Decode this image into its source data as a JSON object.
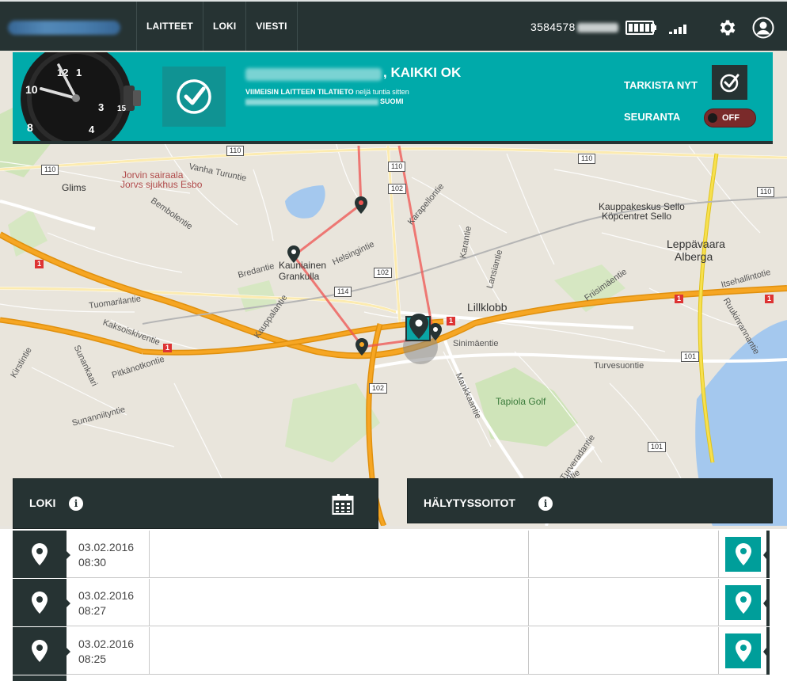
{
  "nav": {
    "links": [
      "LAITTEET",
      "LOKI",
      "VIESTI"
    ],
    "phone_prefix": "3584578",
    "battery_icon": "battery-full-icon",
    "signal_icon": "signal-bars-icon",
    "settings_icon": "gear-icon",
    "profile_icon": "user-icon"
  },
  "status": {
    "title": ", KAIKKI OK",
    "latest_prefix": "VIIMEISIN LAITTEEN TILATIETO",
    "latest_time": " neljä tuntia sitten",
    "country": "SUOMI",
    "check_now_label": "TARKISTA NYT",
    "follow_label": "SEURANTA",
    "follow_toggle": "OFF",
    "accent_color": "#00aaaa",
    "dark_color": "#263333"
  },
  "map": {
    "labels": {
      "jorvi": "Jorvin sairaala",
      "jorvs": "Jorvs sjukhus Esbo",
      "glims": "Glims",
      "vanha": "Vanha Turuntie",
      "bembole": "Bembolentie",
      "kauniainen": "Kauniainen",
      "grankulla": "Grankulla",
      "bredantie": "Bredantie",
      "helsingintie": "Helsingintie",
      "karapellontie": "Karapellontie",
      "kauppakeskus": "Kauppakeskus Sello",
      "kopcentret": "Köpcentret Sello",
      "leppavaara": "Leppävaara",
      "alberga": "Alberga",
      "lillklobb": "Lillklobb",
      "sinimaentie": "Sinimäentie",
      "turvesuontie": "Turvesuontie",
      "tapiola_golf": "Tapiola Golf",
      "tuomarilantie": "Tuomarilantie",
      "kaksoiskiventie": "Kaksoiskiventie",
      "kauppalantie": "Kauppalantie",
      "kirstintie": "Kirstintie",
      "sunankaari": "Sunankaari",
      "pitkanottontie": "Pitkänotkontie",
      "sunanniityntie": "Sunanniityntie",
      "mankkaantie": "Mankkaantie",
      "lansiantie": "Lansiantie",
      "karantie": "Karantie",
      "friisimaentie": "Friisimäentie",
      "itsehallintotie": "Itsehallintotie",
      "ruukinrannantie": "Ruukinrannantie",
      "turveradantie": "Turveradantie",
      "turverantie": "Turverantie"
    },
    "shields": [
      "110",
      "110",
      "110",
      "110",
      "102",
      "102",
      "102",
      "114",
      "101",
      "101",
      "110"
    ],
    "hwy": [
      "1",
      "1",
      "1",
      "1",
      "1"
    ]
  },
  "loki": {
    "label": "LOKI",
    "calendar_icon": "calendar-icon"
  },
  "halytys": {
    "label": "HÄLYTYSSOITOT"
  },
  "log_rows": [
    {
      "date": "03.02.2016",
      "time": "08:30"
    },
    {
      "date": "03.02.2016",
      "time": "08:27"
    },
    {
      "date": "03.02.2016",
      "time": "08:25"
    }
  ]
}
